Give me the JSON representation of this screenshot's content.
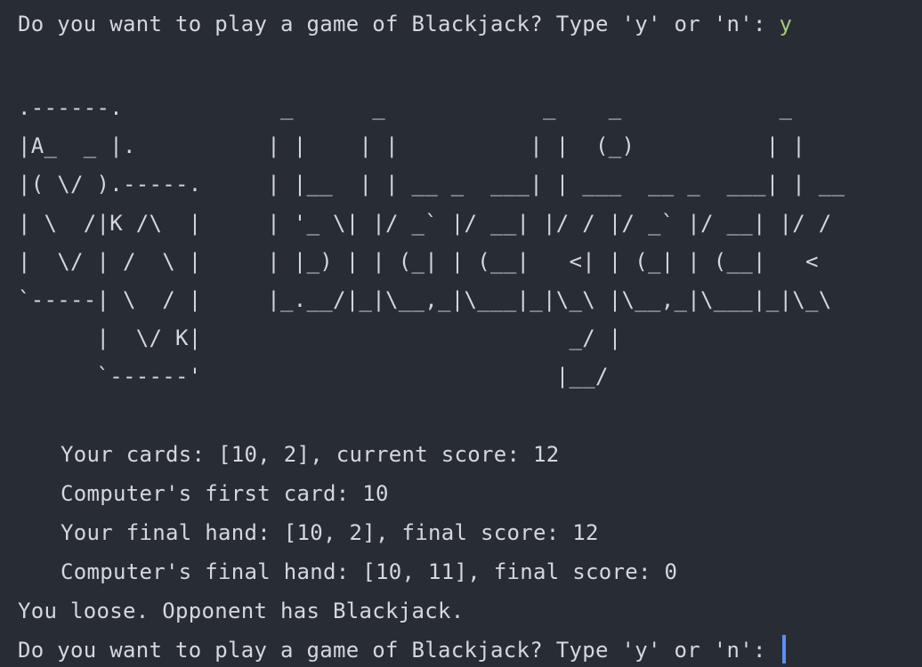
{
  "terminal": {
    "prompt_text": "Do you want to play a game of Blackjack? Type 'y' or 'n': ",
    "user_input": "y",
    "ascii_logo": ".------.            _      _            _    _            _\n|A_  _ |.          | |    | |          | |  (_)          | |\n|( \\/ ).-----.     | |__  | | __ _  ___| | ___  __ _  ___| | __\n| \\  /|K /\\  |     | '_ \\| |/ _` |/ __| |/ / |/ _` |/ __| |/ /\n|  \\/ | /  \\ |     | |_) | | (_| | (__|   <| | (_| | (__|   <\n`-----| \\  / |     |_.__/|_|\\__,_|\\___|_|\\_\\ |\\__,_|\\___|_|\\_\\\n      |  \\/ K|                            _/ |\n      `------'                           |__/",
    "output_lines": [
      "Your cards: [10, 2], current score: 12",
      "Computer's first card: 10",
      "Your final hand: [10, 2], final score: 12",
      "Computer's final hand: [10, 11], final score: 0"
    ],
    "result_text": "You loose. Opponent has Blackjack.",
    "final_prompt_text": "Do you want to play a game of Blackjack? Type 'y' or 'n': ",
    "colors": {
      "background": "#282c34",
      "text": "#d4d7dd",
      "input": "#a6c97b",
      "cursor": "#5b8ff9"
    }
  }
}
